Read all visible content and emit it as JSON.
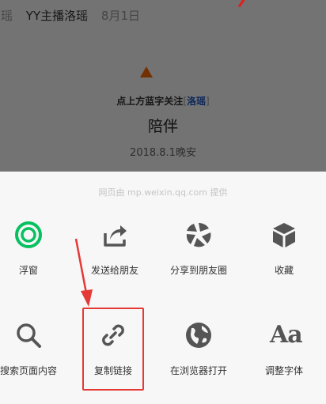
{
  "article": {
    "source_cut": "洛瑶",
    "author": "YY主播洛瑶",
    "date": "8月1日",
    "follow_prefix": "点上方蓝字关注",
    "follow_bracket_open": "[",
    "follow_name": "洛瑶",
    "follow_bracket_close": "]",
    "headline": "陪伴",
    "signature": "2018.8.1晚安"
  },
  "sheet": {
    "provider": "网页由 mp.weixin.qq.com 提供",
    "row1": [
      {
        "label": "浮窗",
        "icon": "float-window-icon"
      },
      {
        "label": "发送给朋友",
        "icon": "share-to-friend-icon"
      },
      {
        "label": "分享到朋友圈",
        "icon": "moments-icon"
      },
      {
        "label": "收藏",
        "icon": "favorite-cube-icon"
      }
    ],
    "row2": [
      {
        "label": "搜索页面内容",
        "icon": "search-icon"
      },
      {
        "label": "复制链接",
        "icon": "link-icon"
      },
      {
        "label": "在浏览器打开",
        "icon": "browser-globe-icon"
      },
      {
        "label": "调整字体",
        "icon": "font-size-icon"
      }
    ]
  },
  "colors": {
    "accent_green": "#07c160",
    "icon_gray": "#555555",
    "annotation_red": "#e53935",
    "link_blue": "#1e57c6"
  }
}
